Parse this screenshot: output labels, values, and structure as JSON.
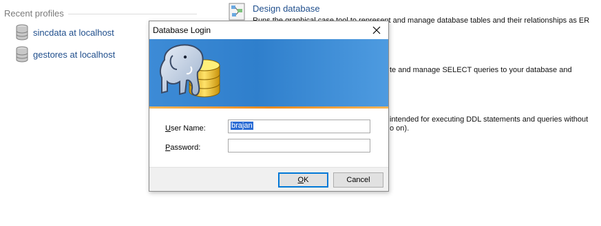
{
  "recent": {
    "header": "Recent profiles",
    "profiles": [
      {
        "label": "sincdata at localhost",
        "icon": "database-icon"
      },
      {
        "label": "gestores at localhost",
        "icon": "database-icon"
      }
    ]
  },
  "actions": {
    "design_title": "Design database",
    "design_desc": "Runs the graphical case tool to represent and manage database tables and their relationships as ER",
    "query_desc": "te and manage SELECT queries to your database and",
    "sql_desc_1": "intended for executing DDL statements and queries without",
    "sql_desc_2": "o on)."
  },
  "dialog": {
    "title": "Database Login",
    "username_label_u": "U",
    "username_label_rest": "ser Name:",
    "username_value": "brajan",
    "password_label_u": "P",
    "password_label_rest": "assword:",
    "password_value": "",
    "ok_label_u": "O",
    "ok_label_rest": "K",
    "cancel_label": "Cancel"
  },
  "colors": {
    "link": "#1f4e8c",
    "banner": "#2f7fcc",
    "accent_stripe": "#e98a1e",
    "selection": "#2b6cd4"
  }
}
